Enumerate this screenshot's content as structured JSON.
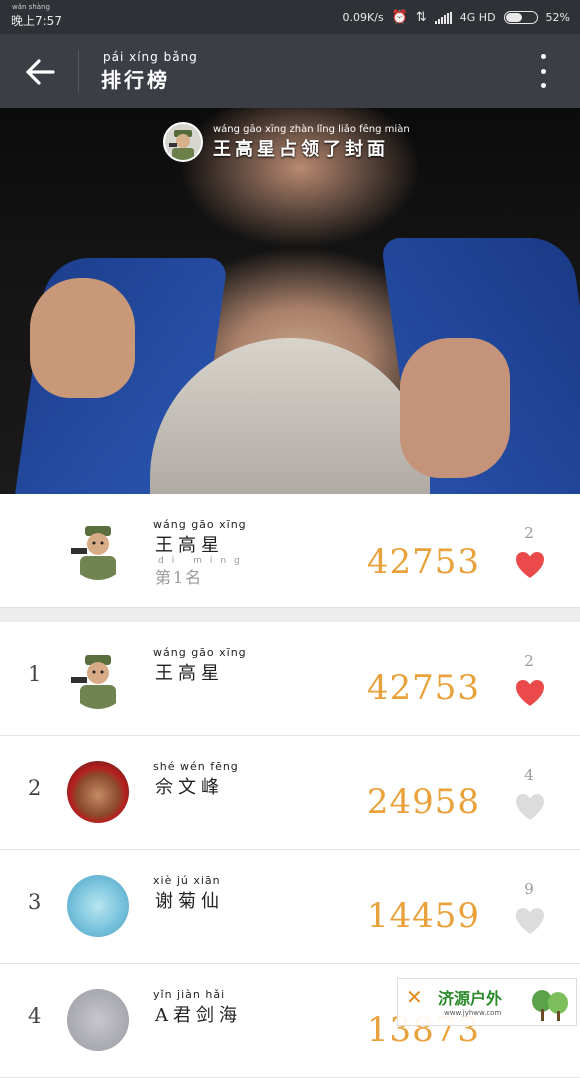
{
  "status_bar": {
    "ruby": "wǎn shàng",
    "time": "晚上7:57",
    "speed": "0.09K/s",
    "network": "4G HD",
    "battery": "52%",
    "battery_level": 0.52
  },
  "header": {
    "title_ruby": "pái xíng bǎng",
    "title": "排行榜"
  },
  "cover": {
    "caption_ruby": "wáng gāo xīng zhàn lǐng liǎo fēng miàn",
    "caption": "王高星占领了封面"
  },
  "my_entry": {
    "name_ruby": "wáng gāo xīng",
    "name": "王高星",
    "sub_ruby": "dì   míng",
    "sub": "第1名",
    "score": "42753",
    "likes": "2",
    "liked": true
  },
  "rows": [
    {
      "rank": "1",
      "name_ruby": "wáng gāo xīng",
      "name": "王高星",
      "score": "42753",
      "likes": "2",
      "liked": true
    },
    {
      "rank": "2",
      "name_ruby": "shé wén fēng",
      "name": "佘文峰",
      "score": "24958",
      "likes": "4",
      "liked": false
    },
    {
      "rank": "3",
      "name_ruby": "xiè jú xiān",
      "name": "谢菊仙",
      "score": "14459",
      "likes": "9",
      "liked": false
    },
    {
      "rank": "4",
      "name_ruby": "yǐn jiàn hǎi",
      "name": "A君剑海",
      "score": "13873",
      "likes": "",
      "liked": false
    }
  ],
  "watermark": {
    "text": "济源户外",
    "url": "www.jyhww.com"
  },
  "colors": {
    "score": "#e9a13b",
    "heart_active": "#ea4a4a",
    "heart_inactive": "#dcdcdc",
    "header_bg": "#3b3f45"
  }
}
